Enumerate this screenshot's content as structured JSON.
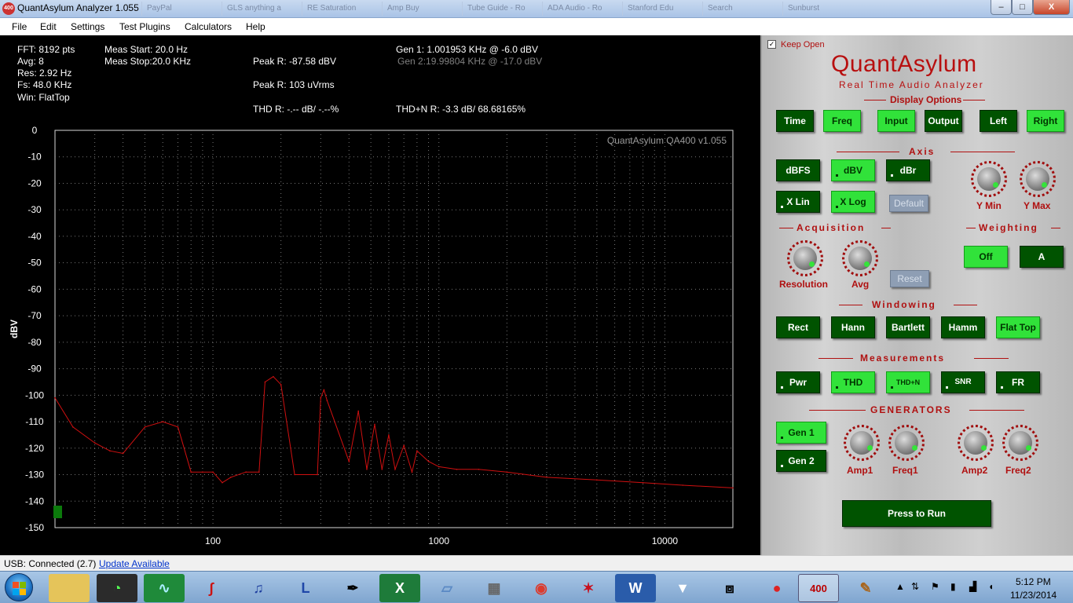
{
  "window": {
    "app_icon": "400",
    "title": "QuantAsylum Analyzer 1.055",
    "bg_tabs": [
      "PayPal",
      "GLS anything a",
      "RE Saturation",
      "Amp Buy",
      "Tube Guide - Ro",
      "ADA Audio - Ro",
      "Stanford Edu",
      "Search",
      "Sunburst"
    ],
    "min_label": "–",
    "max_label": "□",
    "close_label": "X"
  },
  "menu": [
    "File",
    "Edit",
    "Settings",
    "Test Plugins",
    "Calculators",
    "Help"
  ],
  "readout": {
    "fft": "FFT: 8192 pts",
    "avg": "Avg: 8",
    "res": "Res: 2.92 Hz",
    "fs": "Fs: 48.0 KHz",
    "win": "Win: FlatTop",
    "meas_start": "Meas Start: 20.0 Hz",
    "meas_stop": "Meas Stop:20.0 KHz",
    "peak_db": "Peak R: -87.58 dBV",
    "peak_v": "Peak R: 103 uVrms",
    "thd": "THD R: -.-- dB/ -.--%",
    "gen1": "Gen 1: 1.001953 KHz @ -6.0  dBV",
    "gen2": "Gen 2:19.99804 KHz @ -17.0  dBV",
    "thdn": "THD+N R: -3.3 dB/ 68.68165%"
  },
  "chart_data": {
    "type": "line",
    "watermark": "QuantAsylum QA400 v1.055",
    "ylabel": "dBV",
    "xlabel": "",
    "x_scale": "log",
    "xlim": [
      20,
      20000
    ],
    "ylim": [
      -150,
      0
    ],
    "yticks": [
      0,
      -10,
      -20,
      -30,
      -40,
      -50,
      -60,
      -70,
      -80,
      -90,
      -100,
      -110,
      -120,
      -130,
      -140,
      -150
    ],
    "xticks": [
      100,
      1000,
      10000
    ],
    "grid": "dotted",
    "line_color": "#d01010",
    "series": [
      {
        "x": [
          20,
          24,
          30,
          35,
          40,
          50,
          60,
          70,
          80,
          90,
          100,
          110,
          120,
          140,
          160,
          170,
          185,
          200,
          230,
          290,
          300,
          310,
          320,
          400,
          440,
          480,
          520,
          560,
          600,
          640,
          700,
          760,
          800,
          900,
          1000,
          1200,
          1500,
          2000,
          3000,
          5000,
          8000,
          12000,
          20000
        ],
        "y": [
          -101,
          -112,
          -118,
          -121,
          -122,
          -112,
          -110,
          -112,
          -129,
          -129,
          -129,
          -133,
          -131,
          -129,
          -129,
          -95,
          -93,
          -96,
          -130,
          -130,
          -101,
          -98,
          -102,
          -125,
          -106,
          -128,
          -111,
          -128,
          -115,
          -128,
          -119,
          -129,
          -121,
          -125,
          -127,
          -128,
          -128,
          -129,
          -131,
          -132,
          -133,
          -134,
          -135
        ]
      }
    ]
  },
  "panel": {
    "keep_open": "Keep Open",
    "brand": "QuantAsylum",
    "subtitle": "Real Time Audio Analyzer",
    "sections": {
      "display": "Display Options",
      "axis": "Axis",
      "acquisition": "Acquisition",
      "weighting": "Weighting",
      "windowing": "Windowing",
      "measurements": "Measurements",
      "generators": "GENERATORS"
    },
    "buttons": {
      "time": "Time",
      "freq": "Freq",
      "input": "Input",
      "output": "Output",
      "left": "Left",
      "right": "Right",
      "dbfs": "dBFS",
      "dbv": "dBV",
      "dbr": "dBr",
      "xlin": "X Lin",
      "xlog": "X Log",
      "default": "Default",
      "reset": "Reset",
      "off": "Off",
      "a": "A",
      "rect": "Rect",
      "hann": "Hann",
      "bartlett": "Bartlett",
      "hamm": "Hamm",
      "flattop": "Flat Top",
      "pwr": "Pwr",
      "thd": "THD",
      "thdn": "THD+N",
      "snr": "SNR",
      "fr": "FR",
      "gen1": "Gen 1",
      "gen2": "Gen 2",
      "run": "Press to Run"
    },
    "knobs": {
      "ymin": "Y Min",
      "ymax": "Y Max",
      "resolution": "Resolution",
      "avg": "Avg",
      "amp1": "Amp1",
      "freq1": "Freq1",
      "amp2": "Amp2",
      "freq2": "Freq2"
    }
  },
  "status": {
    "usb": "USB: Connected  (2.7)",
    "update": "Update Available"
  },
  "taskbar": {
    "apps": [
      "explorer",
      "meter",
      "pcb",
      "ltspice",
      "audacity",
      "l-app",
      "inkscape",
      "excel",
      "notepad",
      "calculator",
      "chrome",
      "acrobat",
      "word",
      "foobar",
      "frame",
      "recorder",
      "qa400",
      "paint"
    ],
    "qa400_label": "400",
    "time": "5:12 PM",
    "date": "11/23/2014"
  }
}
